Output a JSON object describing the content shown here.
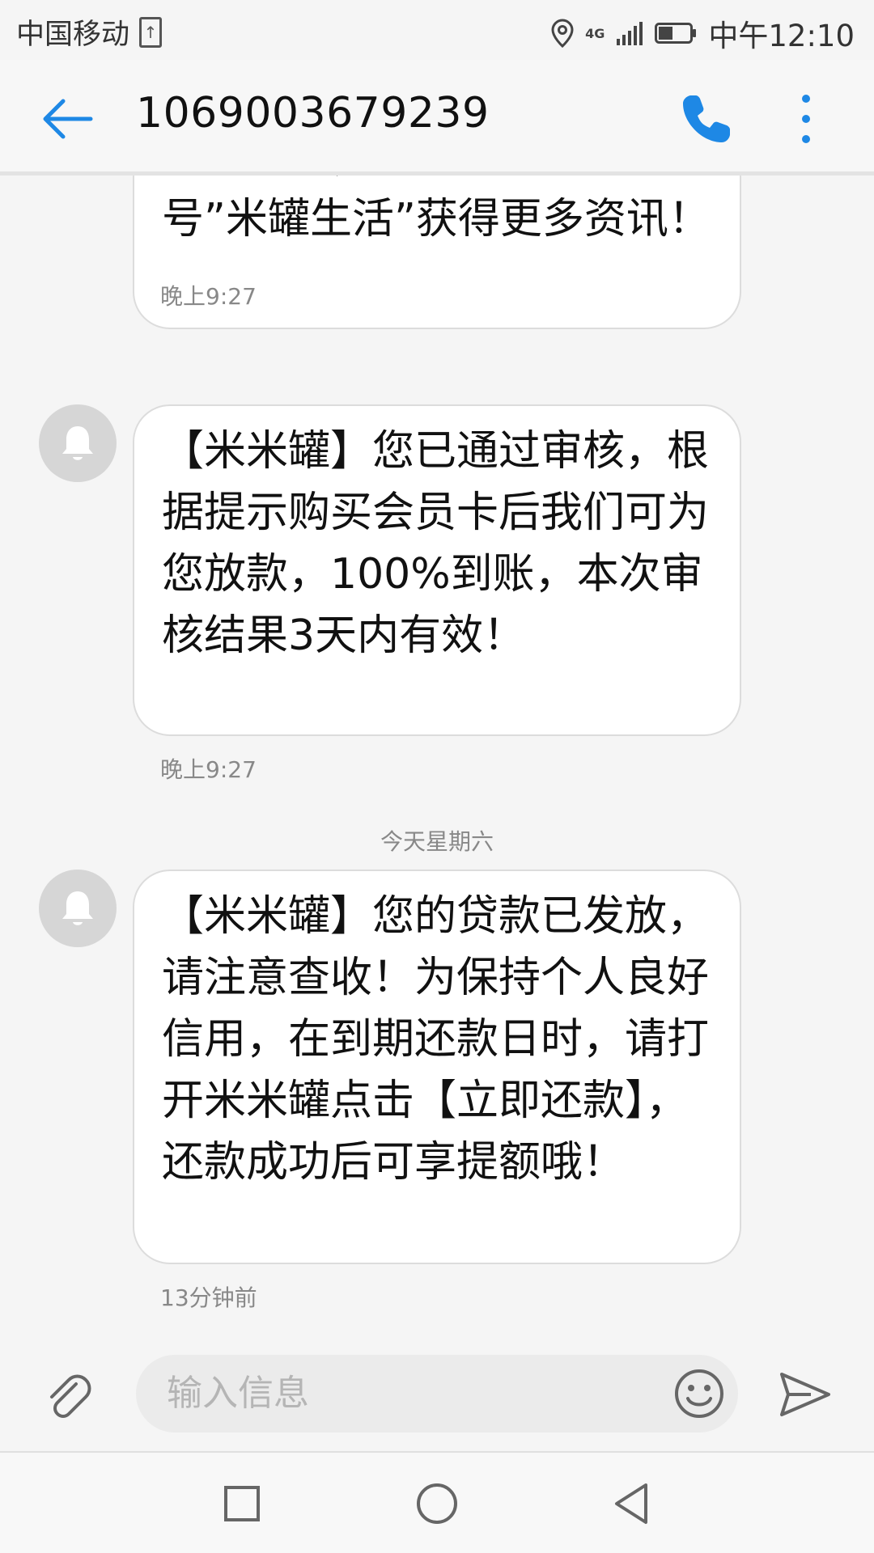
{
  "status_bar": {
    "carrier": "中国移动",
    "network": "4G",
    "time": "中午12:10"
  },
  "header": {
    "title": "1069003679239"
  },
  "messages": [
    {
      "text": "点击好评，关注官方公众号”米罐生活”获得更多资讯！",
      "visible_text": "号”米罐生活”获得更多资讯！",
      "time": "晚上9:27"
    },
    {
      "text": "【米米罐】您已通过审核，根据提示购买会员卡后我们可为您放款，100%到账，本次审核结果3天内有效！",
      "time": "晚上9:27"
    },
    {
      "text": "【米米罐】您的贷款已发放，请注意查收！为保持个人良好信用，在到期还款日时，请打开米米罐点击【立即还款】，还款成功后可享提额哦！",
      "time": "13分钟前"
    }
  ],
  "date_divider": "今天星期六",
  "composer": {
    "placeholder": "输入信息"
  },
  "icons": {
    "back": "back-arrow-icon",
    "call": "phone-icon",
    "more": "more-vertical-icon",
    "avatar": "bell-icon",
    "attach": "paperclip-icon",
    "emoji": "smiley-icon",
    "send": "send-icon",
    "nav_recent": "square-icon",
    "nav_home": "circle-icon",
    "nav_back": "triangle-back-icon"
  },
  "colors": {
    "accent": "#1e88e5",
    "bubble_bg": "#ffffff",
    "avatar_bg": "#d6d6d6",
    "meta_text": "#888888"
  }
}
